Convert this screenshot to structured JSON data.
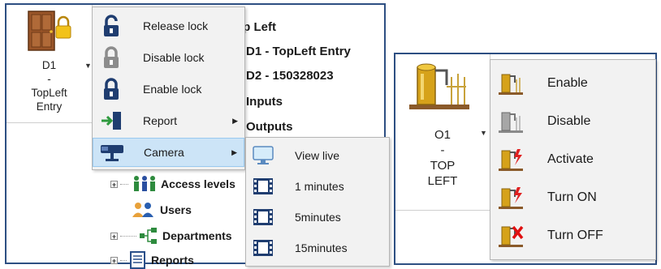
{
  "left": {
    "door_tile": {
      "label_lines": [
        "D1",
        "-",
        "TopLeft",
        "Entry"
      ],
      "icon": "door-with-padlock-icon",
      "dropdown_icon": "dropdown-arrow-icon"
    },
    "background": {
      "labels": [
        "op Left",
        "D1 - TopLeft Entry",
        "D2 - 150328023",
        "Inputs",
        "Outputs"
      ],
      "tree": [
        {
          "label": "Access levels",
          "icon": "access-levels-icon",
          "expandable": true
        },
        {
          "label": "Users",
          "icon": "users-icon",
          "expandable": false
        },
        {
          "label": "Departments",
          "icon": "departments-icon",
          "expandable": true
        },
        {
          "label": "Reports",
          "icon": "reports-icon",
          "expandable": true
        }
      ]
    },
    "context_menu": {
      "items": [
        {
          "label": "Release lock",
          "icon": "padlock-open-icon",
          "submenu": false
        },
        {
          "label": "Disable lock",
          "icon": "padlock-disabled-icon",
          "submenu": false
        },
        {
          "label": "Enable lock",
          "icon": "padlock-closed-icon",
          "submenu": false
        },
        {
          "label": "Report",
          "icon": "report-door-icon",
          "submenu": true
        },
        {
          "label": "Camera",
          "icon": "camera-icon",
          "submenu": true,
          "highlighted": true
        }
      ]
    },
    "camera_submenu": {
      "items": [
        {
          "label": "View live",
          "icon": "monitor-icon"
        },
        {
          "label": "1 minutes",
          "icon": "film-icon"
        },
        {
          "label": "5minutes",
          "icon": "film-icon"
        },
        {
          "label": "15minutes",
          "icon": "film-icon"
        }
      ]
    }
  },
  "right": {
    "output_tile": {
      "label_lines": [
        "O1",
        "-",
        "TOP",
        "LEFT"
      ],
      "icon": "relay-output-icon",
      "dropdown_icon": "dropdown-arrow-icon"
    },
    "context_menu": {
      "items": [
        {
          "label": "Enable",
          "icon": "relay-enable-icon"
        },
        {
          "label": "Disable",
          "icon": "relay-disable-icon"
        },
        {
          "label": "Activate",
          "icon": "relay-activate-icon"
        },
        {
          "label": "Turn ON",
          "icon": "relay-on-icon"
        },
        {
          "label": "Turn OFF",
          "icon": "relay-off-icon"
        }
      ]
    }
  },
  "colors": {
    "frame_border": "#2d4f82",
    "menu_bg": "#f2f2f2",
    "menu_highlight": "#cce4f7",
    "relay_gold": "#d6a21a"
  }
}
